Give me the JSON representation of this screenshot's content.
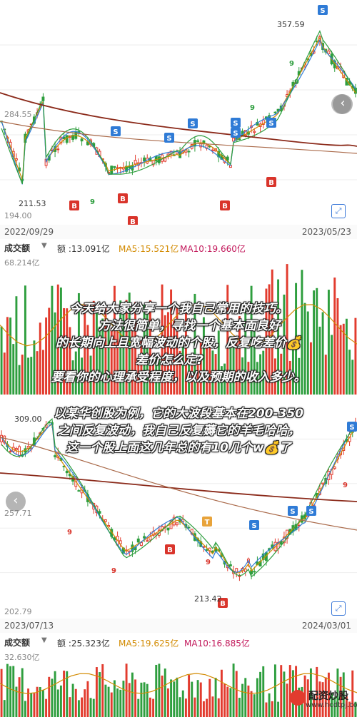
{
  "chart1": {
    "price_top": "357.59",
    "price_upper": "284.55",
    "price_low_point": "211.53",
    "price_bottom": "194.00",
    "date_start": "2022/09/29",
    "date_end": "2023/05/23",
    "markers": {
      "sell": "S",
      "buy": "B",
      "nine": "9"
    }
  },
  "volume1": {
    "label": "成交额",
    "amount": "额 :13.091亿",
    "ma5": "MA5:15.521亿",
    "ma10": "MA10:19.660亿",
    "max": "68.214亿"
  },
  "overlay": {
    "line1": "今天给大家分享一个我自己常用的技巧。",
    "line2": "方法很简单，寻找一个基本面良好",
    "line3": "的长期向上且宽幅波动的个股，反复吃差价💰",
    "line4": "差价怎么定?",
    "line5": "要看你的心理承受程度，以及预期的收入多少。",
    "line6": "以某华创股为例，它的大波段基本在200-350",
    "line7": "之间反复波动，我自己反复薅它的羊毛哈哈，",
    "line8": "这一个股上面这几年总的有10几个w💰了"
  },
  "chart2": {
    "price_top": "309.00",
    "price_mid": "257.71",
    "price_low_point": "213.42",
    "price_bottom": "202.79",
    "date_start": "2023/07/13",
    "date_end": "2024/03/01",
    "markers": {
      "sell": "S",
      "buy": "B",
      "nine": "9",
      "t": "T"
    }
  },
  "volume2": {
    "label": "成交额",
    "amount": "额 :25.323亿",
    "ma5": "MA5:19.625亿",
    "ma10": "MA10:16.885亿",
    "max": "32.630亿"
  },
  "watermark": {
    "name": "配资炒股",
    "site": "www.hcdtpj.com"
  },
  "icons": {
    "zoom": "zoom-icon",
    "nav": "chevron-left-icon",
    "dropdown": "caret-down-icon"
  },
  "colors": {
    "up": "#e23b2e",
    "down": "#2e9e3e",
    "ma_long": "#8b2a1a",
    "sell": "#2f7bd6",
    "buy": "#d9342b"
  }
}
